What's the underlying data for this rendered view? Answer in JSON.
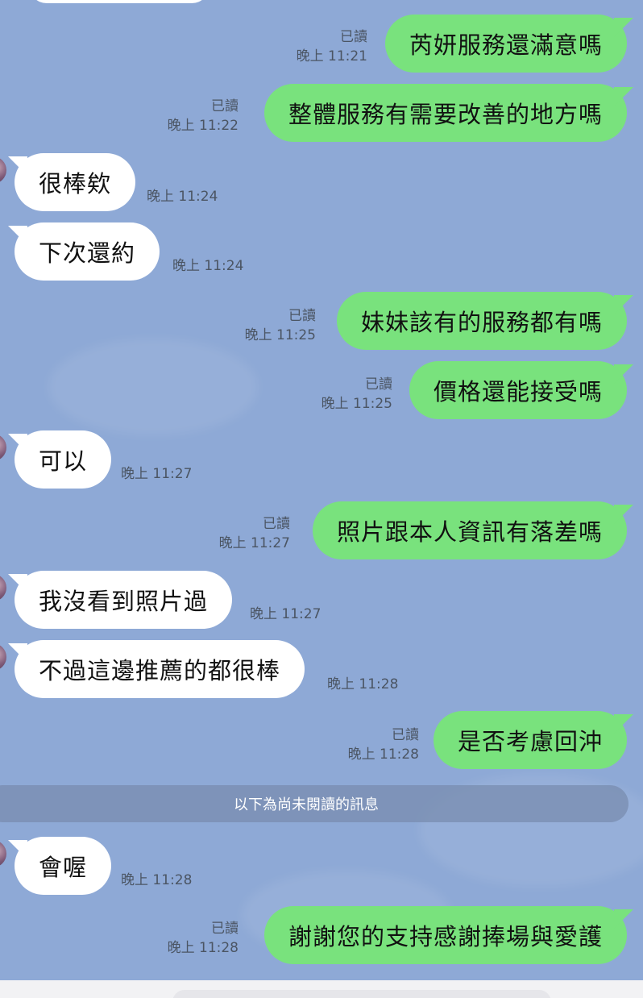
{
  "chat": {
    "divider": "以下為尚未閱讀的訊息",
    "messages": [
      {
        "id": "m1",
        "side": "out",
        "text": "芮妍服務還滿意嗎",
        "read": "已讀",
        "time": "晚上 11:21"
      },
      {
        "id": "m2",
        "side": "out",
        "text": "整體服務有需要改善的地方嗎",
        "read": "已讀",
        "time": "晚上 11:22"
      },
      {
        "id": "m3",
        "side": "in",
        "text": "很棒欸",
        "time": "晚上 11:24"
      },
      {
        "id": "m4",
        "side": "in",
        "text": "下次還約",
        "time": "晚上 11:24"
      },
      {
        "id": "m5",
        "side": "out",
        "text": "妹妹該有的服務都有嗎",
        "read": "已讀",
        "time": "晚上 11:25"
      },
      {
        "id": "m6",
        "side": "out",
        "text": "價格還能接受嗎",
        "read": "已讀",
        "time": "晚上 11:25"
      },
      {
        "id": "m7",
        "side": "in",
        "text": "可以",
        "time": "晚上 11:27"
      },
      {
        "id": "m8",
        "side": "out",
        "text": "照片跟本人資訊有落差嗎",
        "read": "已讀",
        "time": "晚上 11:27"
      },
      {
        "id": "m9",
        "side": "in",
        "text": "我沒看到照片過",
        "time": "晚上 11:27"
      },
      {
        "id": "m10",
        "side": "in",
        "text": "不過這邊推薦的都很棒",
        "time": "晚上 11:28"
      },
      {
        "id": "m11",
        "side": "out",
        "text": "是否考慮回沖",
        "read": "已讀",
        "time": "晚上 11:28"
      },
      {
        "id": "m12",
        "side": "in",
        "text": "會喔",
        "time": "晚上 11:28"
      },
      {
        "id": "m13",
        "side": "out",
        "text": "謝謝您的支持感謝捧場與愛護",
        "read": "已讀",
        "time": "晚上 11:28"
      }
    ]
  },
  "colors": {
    "background": "#8ea9d6",
    "outgoing_bubble": "#79e27d",
    "incoming_bubble": "#ffffff",
    "meta_text": "#4b5563"
  },
  "icons": [
    "avatar"
  ]
}
